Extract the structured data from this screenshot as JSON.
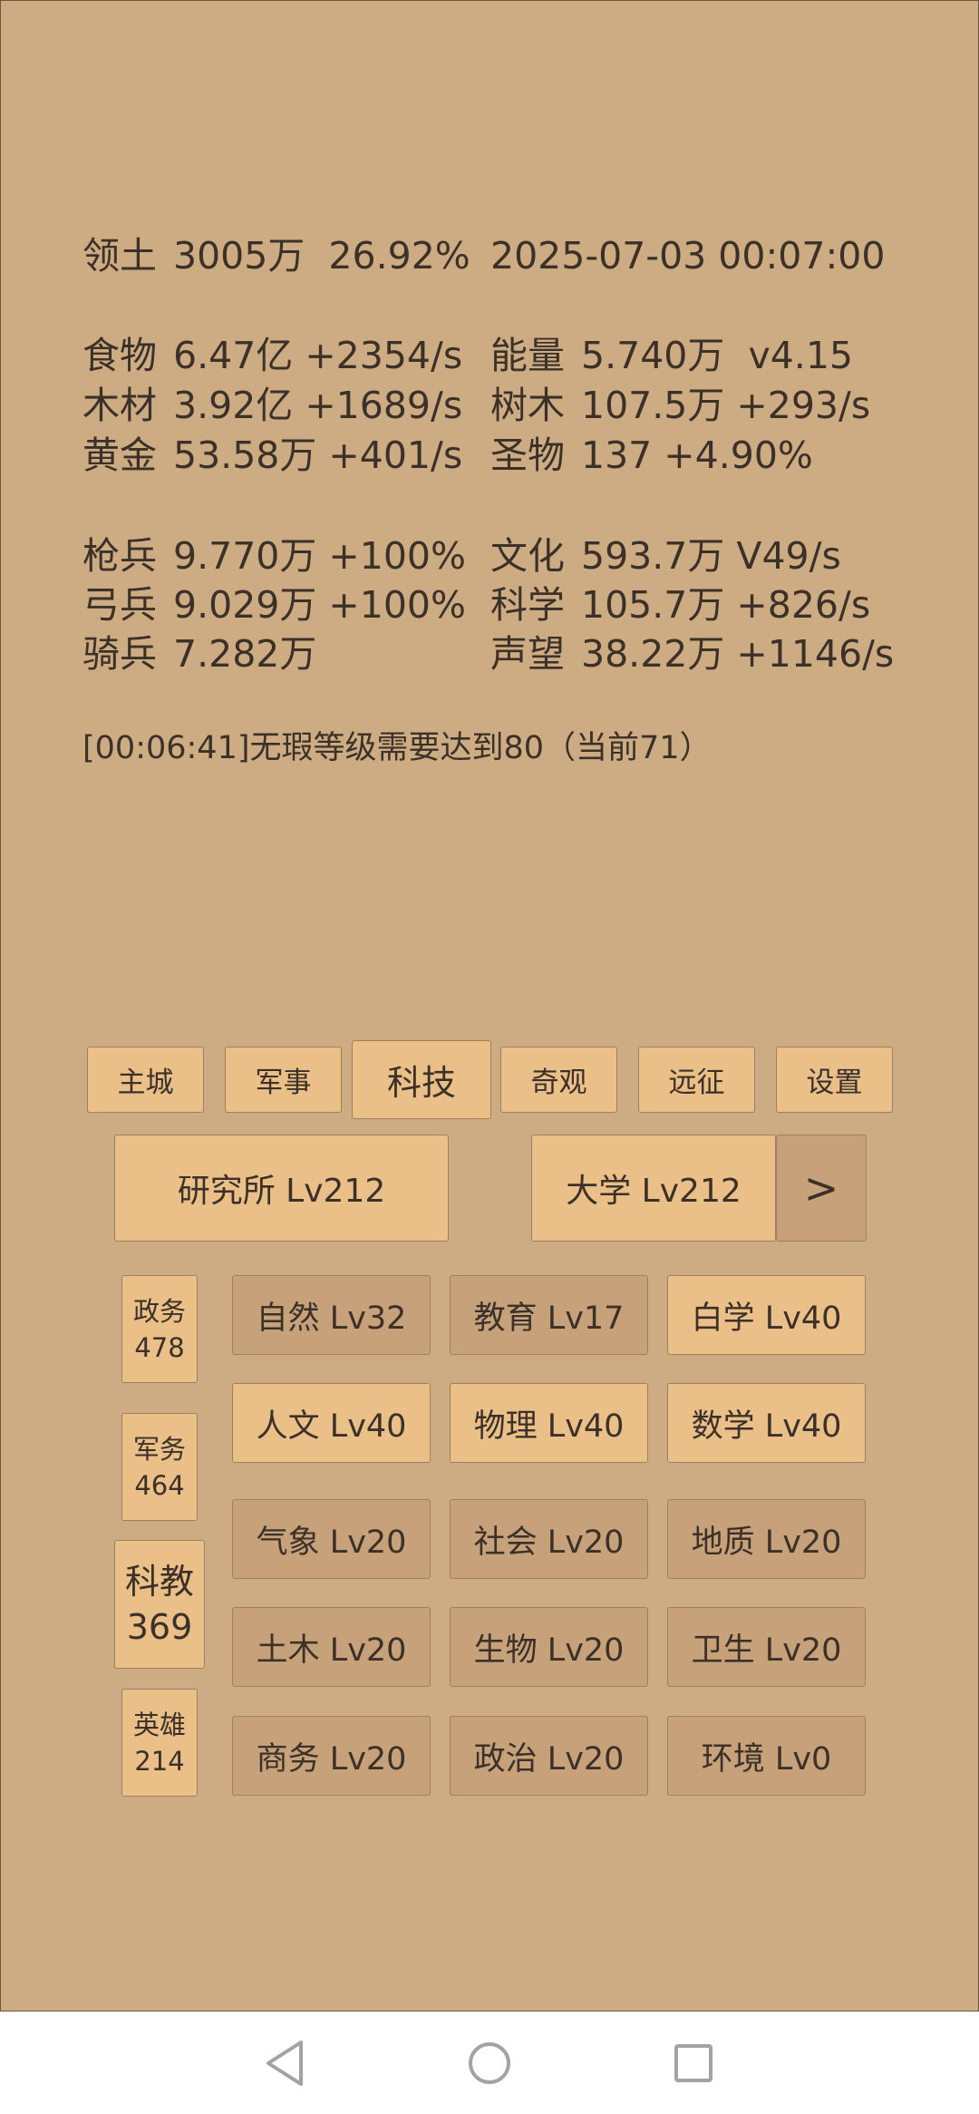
{
  "stats": {
    "territory": {
      "label": "领土",
      "value": "3005万",
      "percent": "26.92%"
    },
    "datetime": "2025-07-03 00:07:00",
    "food": {
      "label": "食物",
      "value": "6.47亿 +2354/s"
    },
    "energy": {
      "label": "能量",
      "value": "5.740万  v4.15"
    },
    "wood": {
      "label": "木材",
      "value": "3.92亿 +1689/s"
    },
    "trees": {
      "label": "树木",
      "value": "107.5万 +293/s"
    },
    "gold": {
      "label": "黄金",
      "value": "53.58万 +401/s"
    },
    "relics": {
      "label": "圣物",
      "value": "137 +4.90%"
    },
    "spearmen": {
      "label": "枪兵",
      "value": "9.770万 +100%"
    },
    "culture": {
      "label": "文化",
      "value": "593.7万 V49/s"
    },
    "archers": {
      "label": "弓兵",
      "value": "9.029万 +100%"
    },
    "science": {
      "label": "科学",
      "value": "105.7万 +826/s"
    },
    "cavalry": {
      "label": "骑兵",
      "value": "7.282万"
    },
    "prestige": {
      "label": "声望",
      "value": "38.22万 +1146/s"
    }
  },
  "message": "[00:06:41]无瑕等级需要达到80（当前71）",
  "tabs": [
    "主城",
    "军事",
    "科技",
    "奇观",
    "远征",
    "设置"
  ],
  "active_tab": "科技",
  "buildings": {
    "institute": "研究所 Lv212",
    "university": "大学 Lv212",
    "next": ">"
  },
  "side": [
    {
      "name": "政务",
      "count": "478"
    },
    {
      "name": "军务",
      "count": "464"
    },
    {
      "name": "科教",
      "count": "369"
    },
    {
      "name": "英雄",
      "count": "214"
    }
  ],
  "sciences": [
    "自然 Lv32",
    "教育 Lv17",
    "白学 Lv40",
    "人文 Lv40",
    "物理 Lv40",
    "数学 Lv40",
    "气象 Lv20",
    "社会 Lv20",
    "地质 Lv20",
    "土木 Lv20",
    "生物 Lv20",
    "卫生 Lv20",
    "商务 Lv20",
    "政治 Lv20",
    "环境 Lv0"
  ],
  "colors": {
    "background": "#cdac84",
    "button_light": "#eabf88",
    "button_dark": "#c7a17a",
    "text": "#3b3128"
  },
  "nav_icons": [
    "back-triangle-icon",
    "home-circle-icon",
    "recents-square-icon"
  ]
}
